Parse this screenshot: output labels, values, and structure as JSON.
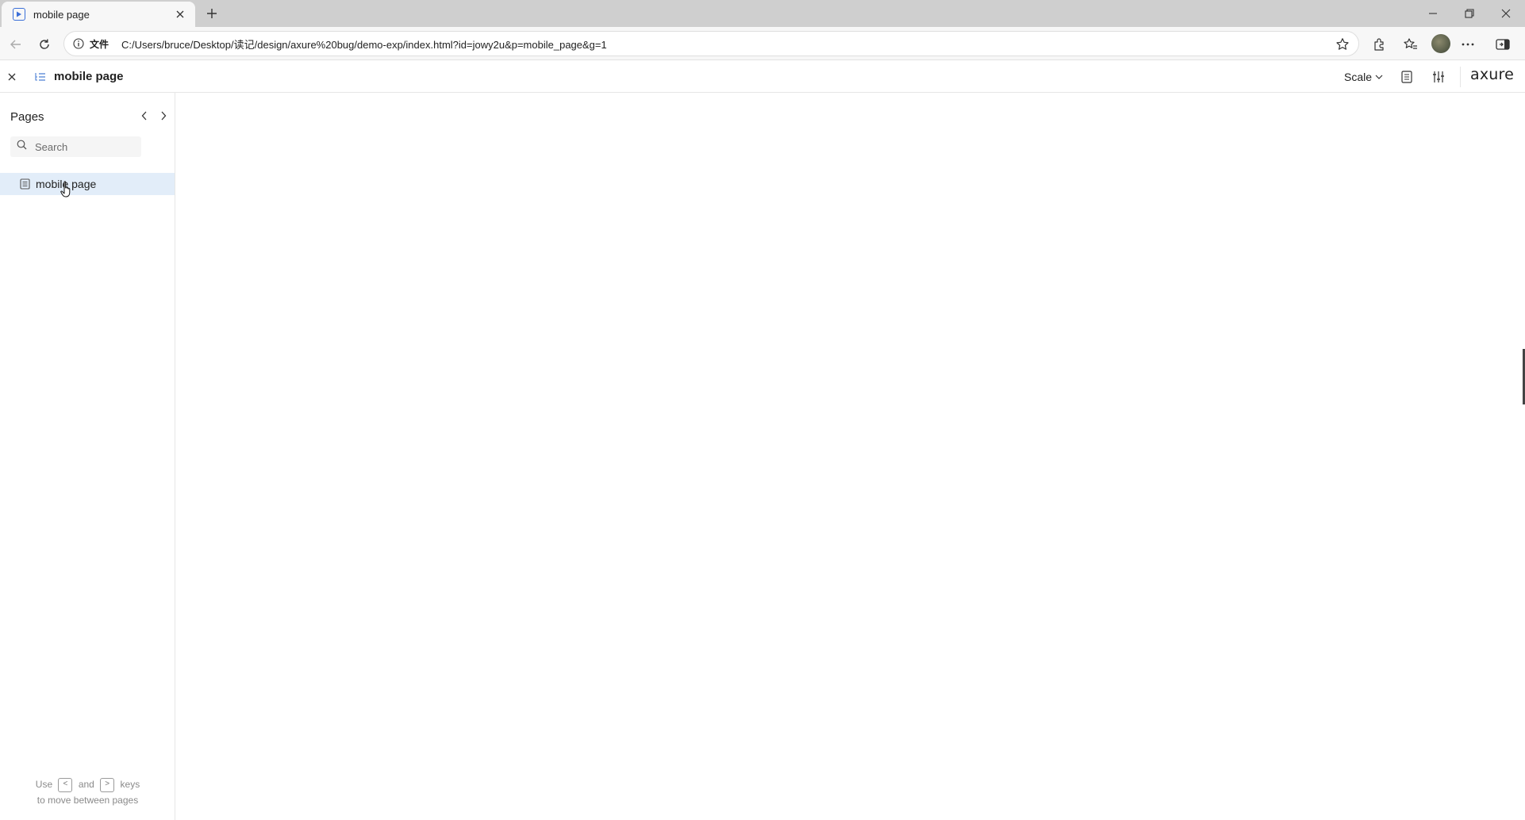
{
  "browser": {
    "tab": {
      "title": "mobile page"
    },
    "address_bar": {
      "security_label": "文件",
      "url": "C:/Users/bruce/Desktop/读记/design/axure%20bug/demo-exp/index.html?id=jowy2u&p=mobile_page&g=1"
    }
  },
  "player": {
    "header": {
      "page_title": "mobile page",
      "scale_label": "Scale",
      "logo": "axure"
    },
    "sidebar": {
      "title": "Pages",
      "search": {
        "placeholder": "Search",
        "value": ""
      },
      "pages": [
        {
          "label": "mobile page",
          "selected": true
        }
      ],
      "hint": {
        "use": "Use",
        "key_prev": "<",
        "and": "and",
        "key_next": ">",
        "keys": "keys",
        "line2": "to move between pages"
      }
    }
  },
  "colors": {
    "selected_row": "#e2edf9",
    "favicon_accent": "#3b6fd8",
    "tabstrip": "#cfcfcf"
  }
}
